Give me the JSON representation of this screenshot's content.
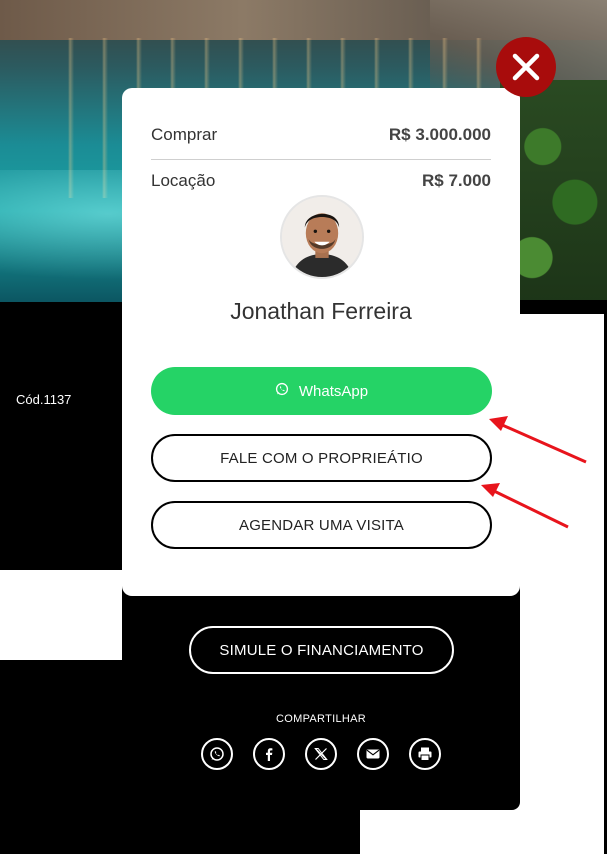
{
  "property": {
    "code": "Cód.1137"
  },
  "prices": [
    {
      "label": "Comprar",
      "value": "R$ 3.000.000"
    },
    {
      "label": "Locação",
      "value": "R$ 7.000"
    }
  ],
  "agent": {
    "name": "Jonathan Ferreira"
  },
  "buttons": {
    "whatsapp": "WhatsApp",
    "owner": "FALE COM O PROPRIEÁTIO",
    "visit": "AGENDAR UMA VISITA",
    "finance": "SIMULE O FINANCIAMENTO"
  },
  "share": {
    "label": "COMPARTILHAR",
    "icons": [
      "whatsapp-icon",
      "facebook-icon",
      "x-icon",
      "email-icon",
      "print-icon"
    ]
  },
  "colors": {
    "whatsapp_green": "#25d366",
    "close_red": "#a80c0c",
    "annotation_red": "#e8141c"
  }
}
